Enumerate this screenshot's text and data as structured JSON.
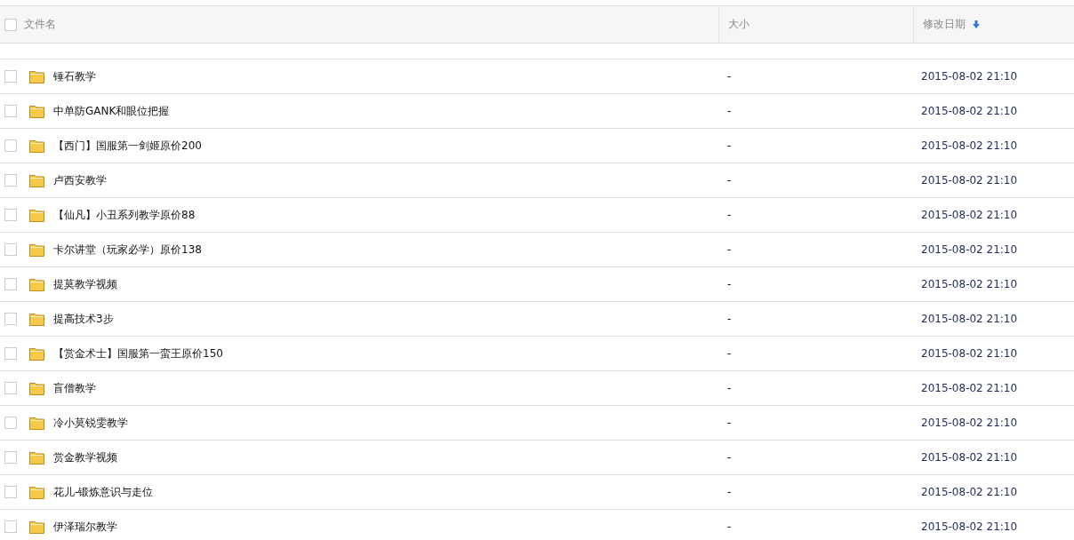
{
  "header": {
    "checked": false,
    "columns": [
      {
        "label": "文件名",
        "sorted": false
      },
      {
        "label": "大小",
        "sorted": false
      },
      {
        "label": "修改日期",
        "sorted": true
      }
    ]
  },
  "rows": [
    {
      "name": "锤石教学",
      "size": "-",
      "modified": "2015-08-02 21:10",
      "checked": false
    },
    {
      "name": "中单防GANK和眼位把握",
      "size": "-",
      "modified": "2015-08-02 21:10",
      "checked": false
    },
    {
      "name": "【西门】国服第一剑姬原价200",
      "size": "-",
      "modified": "2015-08-02 21:10",
      "checked": false
    },
    {
      "name": "卢西安教学",
      "size": "-",
      "modified": "2015-08-02 21:10",
      "checked": false
    },
    {
      "name": "【仙凡】小丑系列教学原价88",
      "size": "-",
      "modified": "2015-08-02 21:10",
      "checked": false
    },
    {
      "name": "卡尔讲堂（玩家必学）原价138",
      "size": "-",
      "modified": "2015-08-02 21:10",
      "checked": false
    },
    {
      "name": "提莫教学视频",
      "size": "-",
      "modified": "2015-08-02 21:10",
      "checked": false
    },
    {
      "name": "提高技术3步",
      "size": "-",
      "modified": "2015-08-02 21:10",
      "checked": false
    },
    {
      "name": "【赏金术士】国服第一蛮王原价150",
      "size": "-",
      "modified": "2015-08-02 21:10",
      "checked": false
    },
    {
      "name": "盲僧教学",
      "size": "-",
      "modified": "2015-08-02 21:10",
      "checked": false
    },
    {
      "name": "冷小莫锐雯教学",
      "size": "-",
      "modified": "2015-08-02 21:10",
      "checked": false
    },
    {
      "name": "赏金教学视频",
      "size": "-",
      "modified": "2015-08-02 21:10",
      "checked": false
    },
    {
      "name": "花儿-锻炼意识与走位",
      "size": "-",
      "modified": "2015-08-02 21:10",
      "checked": false
    },
    {
      "name": "伊泽瑞尔教学",
      "size": "-",
      "modified": "2015-08-02 21:10",
      "checked": false
    }
  ]
}
